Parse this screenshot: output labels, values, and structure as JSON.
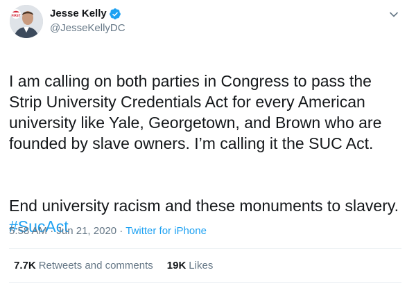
{
  "author": {
    "display_name": "Jesse Kelly",
    "handle": "@JesseKellyDC",
    "verified": true,
    "avatar_badge_text": "FIRST"
  },
  "tweet": {
    "text_para1": "I am calling on both parties in Congress to pass the Strip University Credentials Act for every American university like Yale, Georgetown, and Brown who are founded by slave owners. I’m calling it the SUC Act.",
    "text_para2_prefix": "End university racism and these monuments to slavery. ",
    "hashtag": "#SucAct"
  },
  "meta": {
    "time": "5:58 AM",
    "separator1": " · ",
    "date": "Jun 21, 2020",
    "separator2": " · ",
    "source": "Twitter for iPhone"
  },
  "stats": {
    "retweets_count": "7.7K",
    "retweets_label": "Retweets and comments",
    "likes_count": "19K",
    "likes_label": "Likes"
  },
  "colors": {
    "link": "#1da1f2",
    "text": "#14171a",
    "secondary": "#657786",
    "divider": "#e6ecf0"
  },
  "icons": {
    "verified": "verified-badge-icon",
    "more": "chevron-down-icon"
  }
}
